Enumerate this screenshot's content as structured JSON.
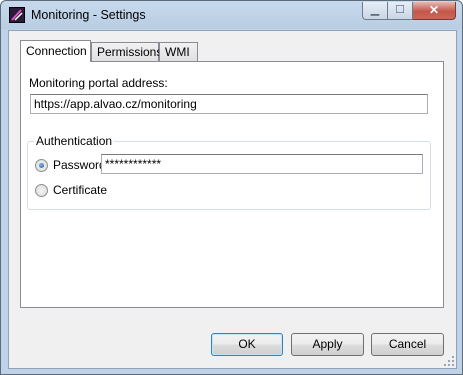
{
  "window": {
    "title": "Monitoring - Settings",
    "icon": "alvao-app-icon"
  },
  "caption_buttons": {
    "minimize": "minimize-icon",
    "maximize": "maximize-icon",
    "close": "close-icon"
  },
  "tabs": [
    {
      "label": "Connection",
      "active": true
    },
    {
      "label": "Permissions",
      "active": false
    },
    {
      "label": "WMI",
      "active": false
    }
  ],
  "connection": {
    "portal_label": "Monitoring portal address:",
    "portal_value": "https://app.alvao.cz/monitoring",
    "auth_group": "Authentication",
    "password_label": "Password",
    "password_value": "************",
    "certificate_label": "Certificate",
    "selected_auth": "Password"
  },
  "footer": {
    "ok_label": "OK",
    "apply_label": "Apply",
    "cancel_label": "Cancel"
  },
  "colors": {
    "frame": "#bfd2e7",
    "accent": "#3c7fb1",
    "close_button": "#c4574a"
  }
}
